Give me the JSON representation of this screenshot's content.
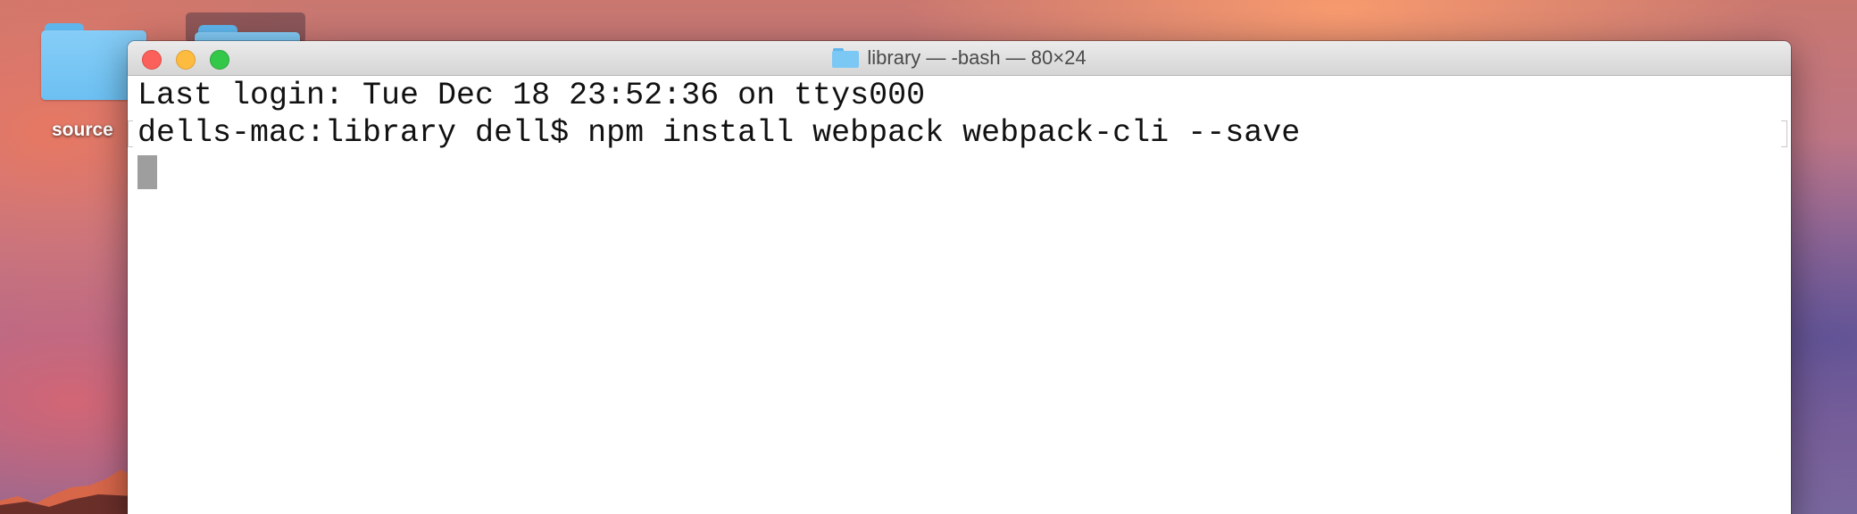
{
  "desktop": {
    "folder_label": "source",
    "folder_icon": "folder-icon"
  },
  "window": {
    "title": "library — -bash — 80×24",
    "title_icon": "folder-icon",
    "buttons": {
      "close": "close-button",
      "minimize": "minimize-button",
      "maximize": "zoom-button"
    }
  },
  "terminal": {
    "lines": [
      "Last login: Tue Dec 18 23:52:36 on ttys000",
      "dells-mac:library dell$ npm install webpack webpack-cli --save"
    ]
  },
  "colors": {
    "close": "#fc605b",
    "minimize": "#fdbc40",
    "maximize": "#34c84a",
    "folder": "#6cc0f2",
    "cursor": "#9e9e9e"
  }
}
